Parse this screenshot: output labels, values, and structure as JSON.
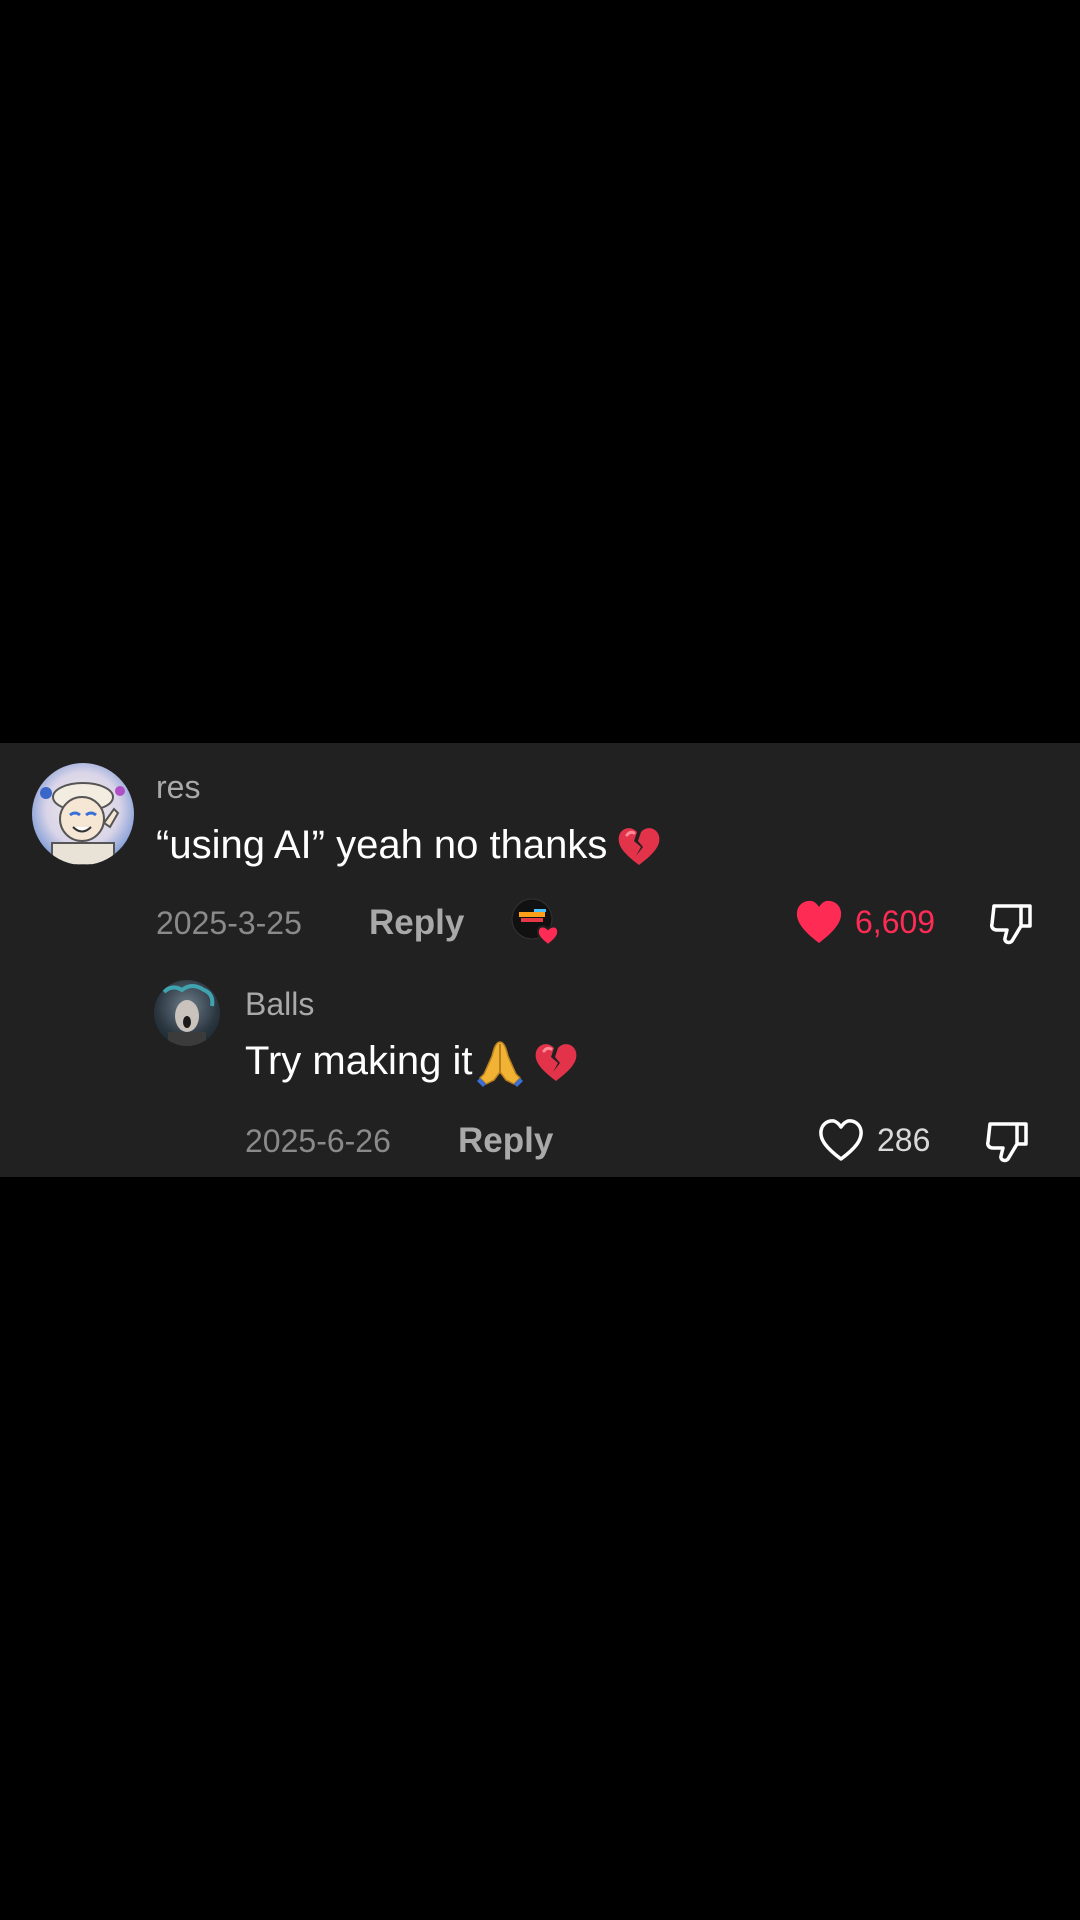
{
  "comment": {
    "username": "res",
    "text": "“using AI” yeah no thanks",
    "emoji": "broken-heart",
    "date": "2025-3-25",
    "reply_label": "Reply",
    "creator_liked_badge_icon": "creator-liked-badge-icon",
    "liked": true,
    "like_count": "6,609",
    "dislike_icon": "thumbs-down-icon"
  },
  "reply": {
    "username": "Balls",
    "text": "Try making it",
    "emojis": [
      "folded-hands",
      "broken-heart"
    ],
    "date": "2025-6-26",
    "reply_label": "Reply",
    "liked": false,
    "like_count": "286",
    "dislike_icon": "thumbs-down-icon"
  },
  "colors": {
    "background": "#000000",
    "panel": "#212121",
    "liked": "#fe2c55",
    "text_primary": "#ffffff",
    "text_secondary": "#a9a9a9",
    "text_muted": "#8a8a8a"
  }
}
